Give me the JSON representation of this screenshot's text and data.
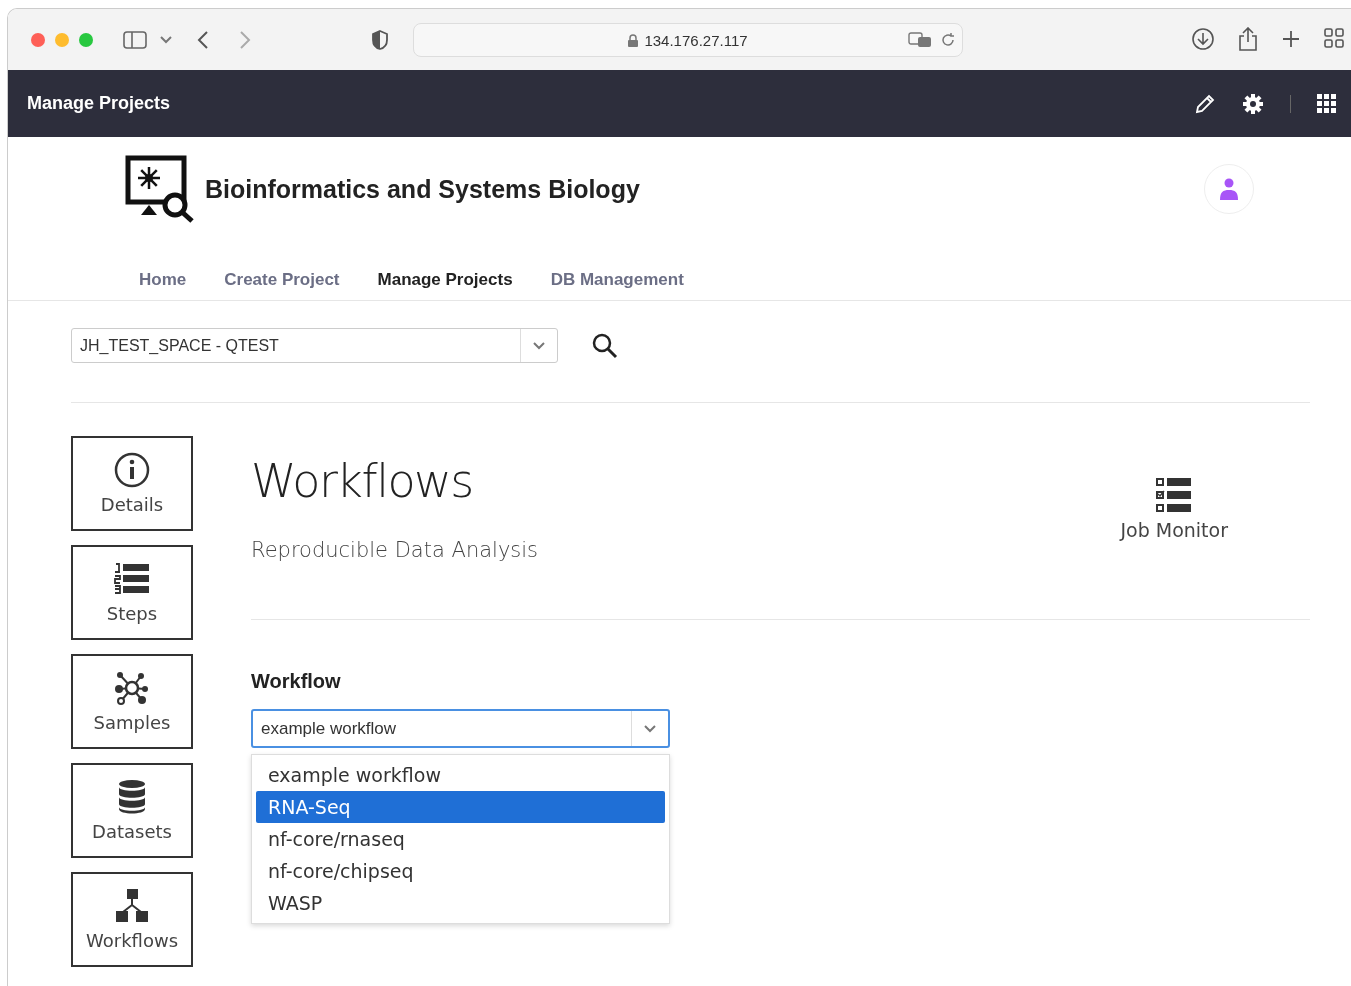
{
  "browser": {
    "address": "134.176.27.117"
  },
  "app_bar": {
    "title": "Manage Projects"
  },
  "header": {
    "title": "Bioinformatics and Systems Biology"
  },
  "nav": [
    {
      "label": "Home",
      "selected": false
    },
    {
      "label": "Create Project",
      "selected": false
    },
    {
      "label": "Manage Projects",
      "selected": true
    },
    {
      "label": "DB Management",
      "selected": false
    }
  ],
  "project_select": {
    "value": "JH_TEST_SPACE - QTEST"
  },
  "side_nav": [
    {
      "label": "Details",
      "kind": "details"
    },
    {
      "label": "Steps",
      "kind": "steps"
    },
    {
      "label": "Samples",
      "kind": "samples"
    },
    {
      "label": "Datasets",
      "kind": "datasets"
    },
    {
      "label": "Workflows",
      "kind": "workflows"
    }
  ],
  "main": {
    "title": "Workflows",
    "subtitle": "Reproducible Data Analysis",
    "job_monitor": "Job Monitor",
    "field_label": "Workflow",
    "value": "example workflow",
    "options": [
      {
        "label": "example workflow",
        "highlighted": false
      },
      {
        "label": "RNA-Seq",
        "highlighted": true
      },
      {
        "label": "nf-core/rnaseq",
        "highlighted": false
      },
      {
        "label": "nf-core/chipseq",
        "highlighted": false
      },
      {
        "label": "WASP",
        "highlighted": false
      }
    ]
  }
}
